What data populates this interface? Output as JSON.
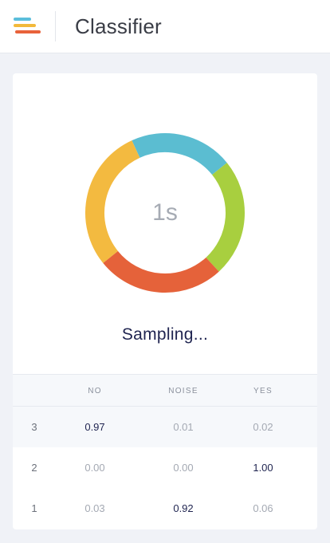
{
  "header": {
    "title": "Classifier",
    "logo_colors": [
      "#5bbedb",
      "#f2b93b",
      "#e8623a"
    ]
  },
  "progress": {
    "timer": "1s",
    "status": "Sampling...",
    "segments": [
      {
        "color": "#5bbdd1",
        "from": 0.0,
        "to": 0.21
      },
      {
        "color": "#a8cf3f",
        "from": 0.21,
        "to": 0.45
      },
      {
        "color": "#e5623a",
        "from": 0.45,
        "to": 0.71
      },
      {
        "color": "#f3ba40",
        "from": 0.71,
        "to": 1.0
      }
    ]
  },
  "table": {
    "headers": [
      "NO",
      "NOISE",
      "YES"
    ],
    "rows": [
      {
        "index": "3",
        "values": [
          "0.97",
          "0.01",
          "0.02"
        ],
        "highlight": 0
      },
      {
        "index": "2",
        "values": [
          "0.00",
          "0.00",
          "1.00"
        ],
        "highlight": 2
      },
      {
        "index": "1",
        "values": [
          "0.03",
          "0.92",
          "0.06"
        ],
        "highlight": 1
      }
    ]
  }
}
